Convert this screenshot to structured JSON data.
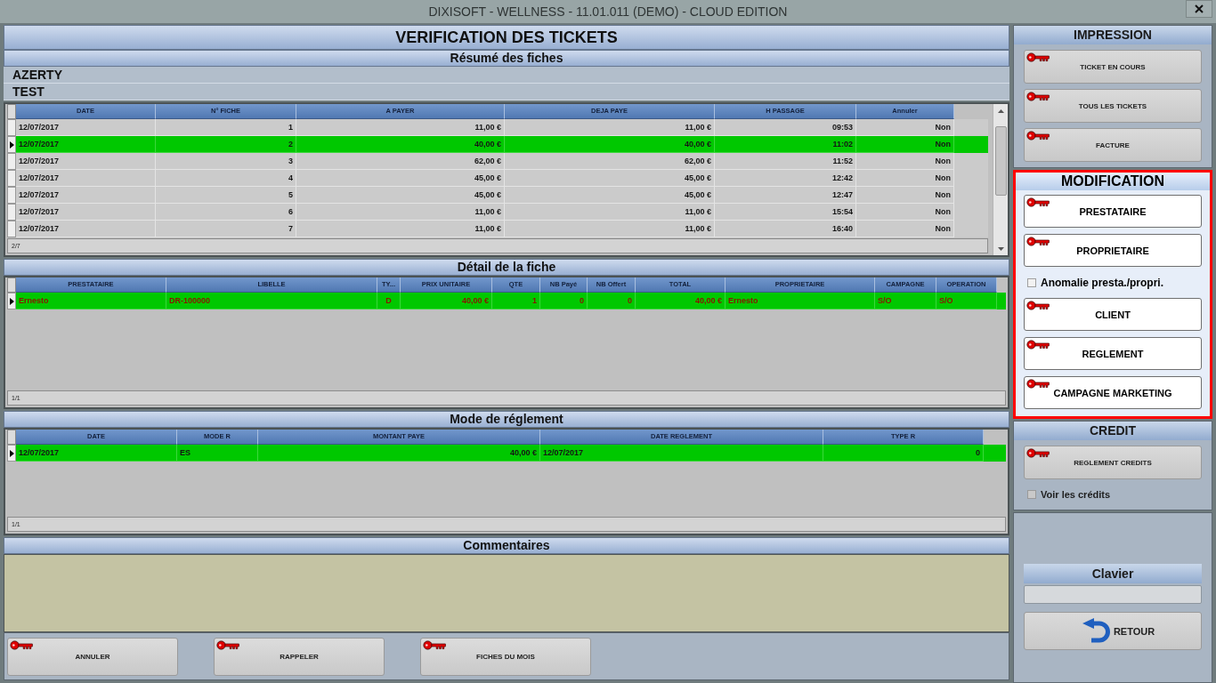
{
  "window": {
    "title": "DIXISOFT - WELLNESS - 11.01.011 (DEMO) - CLOUD EDITION"
  },
  "main": {
    "title": "VERIFICATION DES TICKETS"
  },
  "summary": {
    "title": "Résumé des fiches",
    "lines": [
      "AZERTY",
      "TEST"
    ],
    "table": {
      "columns": [
        {
          "label": "DATE",
          "kind": "text"
        },
        {
          "label": "N° FICHE",
          "kind": "number"
        },
        {
          "label": "A PAYER",
          "kind": "number"
        },
        {
          "label": "DEJA PAYE",
          "kind": "number"
        },
        {
          "label": "H PASSAGE",
          "kind": "number"
        },
        {
          "label": "Annuler",
          "kind": "number"
        }
      ],
      "rows": [
        {
          "cells": [
            "12/07/2017",
            "1",
            "11,00 €",
            "11,00 €",
            "09:53",
            "Non"
          ],
          "selected": false
        },
        {
          "cells": [
            "12/07/2017",
            "2",
            "40,00 €",
            "40,00 €",
            "11:02",
            "Non"
          ],
          "selected": true
        },
        {
          "cells": [
            "12/07/2017",
            "3",
            "62,00 €",
            "62,00 €",
            "11:52",
            "Non"
          ],
          "selected": false
        },
        {
          "cells": [
            "12/07/2017",
            "4",
            "45,00 €",
            "45,00 €",
            "12:42",
            "Non"
          ],
          "selected": false
        },
        {
          "cells": [
            "12/07/2017",
            "5",
            "45,00 €",
            "45,00 €",
            "12:47",
            "Non"
          ],
          "selected": false
        },
        {
          "cells": [
            "12/07/2017",
            "6",
            "11,00 €",
            "11,00 €",
            "15:54",
            "Non"
          ],
          "selected": false
        },
        {
          "cells": [
            "12/07/2017",
            "7",
            "11,00 €",
            "11,00 €",
            "16:40",
            "Non"
          ],
          "selected": false
        }
      ],
      "footer": "2/7"
    }
  },
  "detail": {
    "title": "Détail de la fiche",
    "table": {
      "columns": [
        {
          "label": "PRESTATAIRE",
          "kind": "text"
        },
        {
          "label": "LIBELLE",
          "kind": "text"
        },
        {
          "label": "TY...",
          "kind": "code"
        },
        {
          "label": "PRIX UNITAIRE",
          "kind": "number"
        },
        {
          "label": "QTE",
          "kind": "number"
        },
        {
          "label": "NB Payé",
          "kind": "number"
        },
        {
          "label": "NB Offert",
          "kind": "number"
        },
        {
          "label": "TOTAL",
          "kind": "number"
        },
        {
          "label": "PROPRIETAIRE",
          "kind": "text"
        },
        {
          "label": "CAMPAGNE",
          "kind": "text"
        },
        {
          "label": "OPERATION",
          "kind": "text"
        }
      ],
      "rows": [
        {
          "cells": [
            "Ernesto",
            "DR-100000",
            "D",
            "40,00 €",
            "1",
            "0",
            "0",
            "40,00 €",
            "Ernesto",
            "S/O",
            "S/O"
          ],
          "selected": true
        }
      ],
      "footer": "1/1"
    }
  },
  "payment": {
    "title": "Mode de réglement",
    "table": {
      "columns": [
        {
          "label": "DATE",
          "kind": "text"
        },
        {
          "label": "MODE R",
          "kind": "text"
        },
        {
          "label": "MONTANT PAYE",
          "kind": "number"
        },
        {
          "label": "DATE REGLEMENT",
          "kind": "text"
        },
        {
          "label": "TYPE R",
          "kind": "number"
        }
      ],
      "rows": [
        {
          "cells": [
            "12/07/2017",
            "ES",
            "40,00 €",
            "12/07/2017",
            "0"
          ],
          "selected": true
        }
      ],
      "footer": "1/1"
    }
  },
  "comments": {
    "title": "Commentaires"
  },
  "bottom_buttons": [
    "ANNULER",
    "RAPPELER",
    "FICHES DU MOIS"
  ],
  "sidebar": {
    "sections": [
      {
        "title": "IMPRESSION",
        "highlighted": false,
        "items": [
          {
            "kind": "button",
            "label": "TICKET EN COURS"
          },
          {
            "kind": "button",
            "label": "TOUS LES TICKETS"
          },
          {
            "kind": "button",
            "label": "FACTURE"
          }
        ]
      },
      {
        "title": "MODIFICATION",
        "highlighted": true,
        "items": [
          {
            "kind": "button",
            "label": "PRESTATAIRE"
          },
          {
            "kind": "button",
            "label": "PROPRIETAIRE"
          },
          {
            "kind": "checkbox",
            "label": "Anomalie presta./propri.",
            "checked": false
          },
          {
            "kind": "button",
            "label": "CLIENT"
          },
          {
            "kind": "button",
            "label": "REGLEMENT"
          },
          {
            "kind": "button",
            "label": "CAMPAGNE MARKETING"
          }
        ]
      },
      {
        "title": "CREDIT",
        "highlighted": false,
        "items": [
          {
            "kind": "button",
            "label": "REGLEMENT CREDITS"
          },
          {
            "kind": "checkbox",
            "label": "Voir les crédits",
            "checked": false
          }
        ]
      }
    ]
  },
  "keyboard": {
    "title": "Clavier"
  },
  "return_button": {
    "label": "RETOUR"
  }
}
